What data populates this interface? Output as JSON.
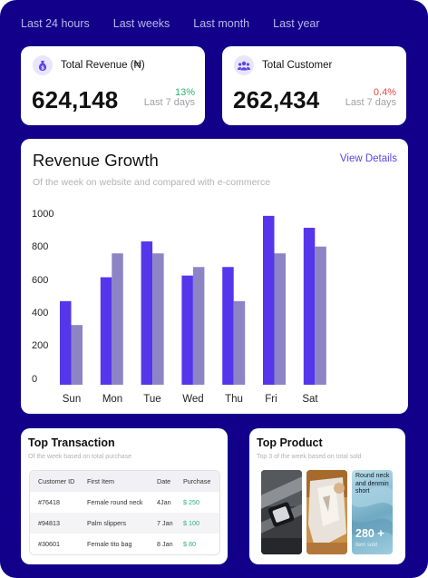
{
  "filters": [
    "Last 24 hours",
    "Last weeks",
    "Last month",
    "Last year"
  ],
  "kpis": [
    {
      "title": "Total Revenue (₦)",
      "value": "624,148",
      "change": "13%",
      "period": "Last 7 days",
      "change_color": "#2db36f",
      "icon": "money-bag-icon"
    },
    {
      "title": "Total Customer",
      "value": "262,434",
      "change": "0.4%",
      "period": "Last 7 days",
      "change_color": "#e5484d",
      "icon": "users-icon"
    }
  ],
  "revenue_growth": {
    "title": "Revenue Growth",
    "subtitle": "Of the week on website and compared with e-commerce",
    "view_details": "View Details"
  },
  "chart_data": {
    "type": "bar",
    "categories": [
      "Sun",
      "Mon",
      "Tue",
      "Wed",
      "Thu",
      "Fri",
      "Sat"
    ],
    "series": [
      {
        "values": [
          490,
          630,
          840,
          640,
          690,
          990,
          920
        ],
        "color": "#5536ea"
      },
      {
        "values": [
          350,
          770,
          770,
          690,
          490,
          770,
          810
        ],
        "color": "#8d84c6"
      }
    ],
    "yticks": [
      "1000",
      "800",
      "600",
      "400",
      "200",
      "0"
    ],
    "ylim": [
      0,
      1000
    ],
    "xlabel": "",
    "ylabel": "",
    "grid": false
  },
  "top_transaction": {
    "title": "Top Transaction",
    "subtitle": "Of the week based on total purchase",
    "columns": [
      "Customer ID",
      "First Item",
      "Date",
      "Purchase"
    ],
    "rows": [
      [
        "#76418",
        "Female round neck",
        "4Jan",
        "$ 250"
      ],
      [
        "#94813",
        "Palm slippers",
        "7 Jan",
        "$ 100"
      ],
      [
        "#30601",
        "Female tito bag",
        "8 Jan",
        "$ 80"
      ]
    ]
  },
  "top_product": {
    "title": "Top Product",
    "subtitle": "Top 3 of the week based on total sold",
    "featured": {
      "name": "Round neck and denmin short",
      "count": "280 +",
      "unit": "item sold"
    }
  }
}
